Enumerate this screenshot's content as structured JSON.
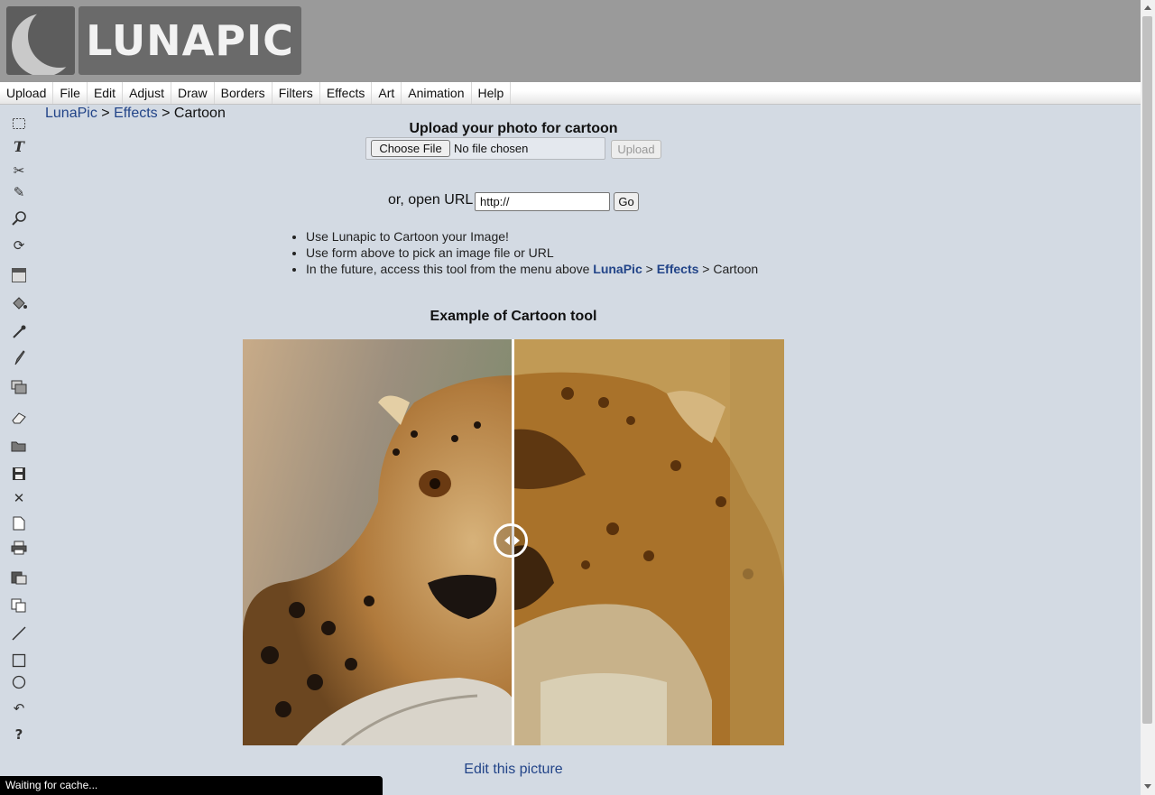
{
  "logo": {
    "text": "LUNAPIC"
  },
  "menu": [
    "Upload",
    "File",
    "Edit",
    "Adjust",
    "Draw",
    "Borders",
    "Filters",
    "Effects",
    "Art",
    "Animation",
    "Help"
  ],
  "breadcrumb": {
    "home": "LunaPic",
    "sep1": " > ",
    "section": "Effects",
    "sep2": " > ",
    "current": "Cartoon"
  },
  "upload": {
    "title": "Upload your photo for cartoon",
    "choose_label": "Choose File",
    "no_file": "No file chosen",
    "upload_label": "Upload"
  },
  "url": {
    "label": "or, open URL",
    "value": "http://",
    "go_label": "Go"
  },
  "bullets": {
    "b1": "Use Lunapic to Cartoon your Image!",
    "b2": "Use form above to pick an image file or URL",
    "b3_prefix": "In the future, access this tool from the menu above ",
    "b3_home": "LunaPic",
    "b3_sep1": " > ",
    "b3_section": "Effects",
    "b3_sep2": " > ",
    "b3_current": "Cartoon"
  },
  "example": {
    "title": "Example of Cartoon tool",
    "edit_link": "Edit this picture"
  },
  "status": "Waiting for cache...",
  "tools": [
    "select-icon",
    "text-icon",
    "scissors-icon",
    "pencil-icon",
    "magnifier-icon",
    "rotate-icon",
    "gradient-icon",
    "paint-bucket-icon",
    "eyedropper-icon",
    "brush-icon",
    "layers-icon",
    "eraser-icon",
    "open-folder-icon",
    "save-icon",
    "close-icon",
    "new-page-icon",
    "print-icon",
    "paste-icon",
    "copy-icon",
    "line-icon",
    "rectangle-icon",
    "circle-icon",
    "undo-icon",
    "help-icon"
  ],
  "colors": {
    "header_bg": "#9a9a9a",
    "page_bg": "#d3dae3",
    "link": "#224488",
    "status_bg": "#000000"
  }
}
